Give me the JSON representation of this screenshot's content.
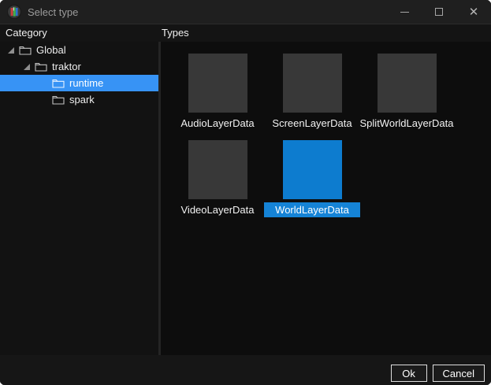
{
  "window": {
    "title": "Select type",
    "controls": {
      "minimize": "minimize",
      "maximize": "maximize",
      "close": "✕"
    }
  },
  "headers": {
    "category": "Category",
    "types": "Types"
  },
  "tree": {
    "items": [
      {
        "label": "Global",
        "level": 0,
        "expanded": true,
        "selected": false
      },
      {
        "label": "traktor",
        "level": 1,
        "expanded": true,
        "selected": false
      },
      {
        "label": "runtime",
        "level": 2,
        "expanded": false,
        "selected": true
      },
      {
        "label": "spark",
        "level": 2,
        "expanded": false,
        "selected": false
      }
    ]
  },
  "types_grid": {
    "items": [
      {
        "label": "AudioLayerData",
        "selected": false
      },
      {
        "label": "ScreenLayerData",
        "selected": false
      },
      {
        "label": "SplitWorldLayerData",
        "selected": false
      },
      {
        "label": "VideoLayerData",
        "selected": false
      },
      {
        "label": "WorldLayerData",
        "selected": true
      }
    ]
  },
  "footer": {
    "ok_label": "Ok",
    "cancel_label": "Cancel"
  },
  "colors": {
    "tree_selection": "#3793f5",
    "tile_selected": "#0d7ccf",
    "tile_label_selected_bg": "#1583d6",
    "tile_gray": "#383838",
    "titlebar_bg": "#1f1f1f",
    "panel_bg": "#0d0d0d",
    "footer_bg": "#161616"
  }
}
